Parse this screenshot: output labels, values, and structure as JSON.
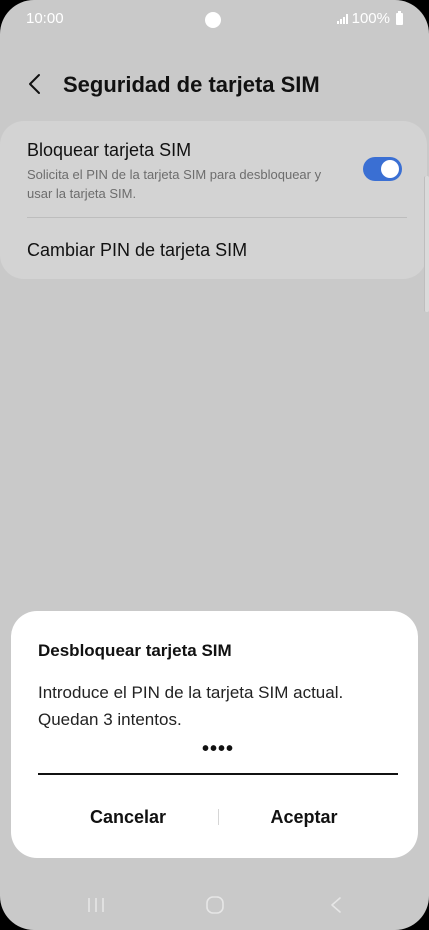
{
  "status_bar": {
    "time": "10:00",
    "battery": "100%",
    "icons": [
      "camera-cutout-icon",
      "signal-icon",
      "battery-icon"
    ]
  },
  "header": {
    "back_icon": "chevron-left-icon",
    "title": "Seguridad de tarjeta SIM"
  },
  "settings": {
    "lock_sim": {
      "title": "Bloquear tarjeta SIM",
      "description": "Solicita el PIN de la tarjeta SIM para desbloquear y usar la tarjeta SIM.",
      "enabled": true
    },
    "change_pin": {
      "title": "Cambiar PIN de tarjeta SIM"
    }
  },
  "dialog": {
    "title": "Desbloquear tarjeta SIM",
    "message": "Introduce el PIN de la tarjeta SIM actual. Quedan 3 intentos.",
    "pin_value": "••••",
    "cancel_label": "Cancelar",
    "accept_label": "Aceptar"
  },
  "nav_bar": {
    "icons": [
      "recent-apps-icon",
      "home-icon",
      "back-icon"
    ]
  },
  "colors": {
    "accent": "#3a6fd3",
    "background": "#c9c9c9",
    "card": "#d3d3d3",
    "dialog": "#ffffff"
  }
}
